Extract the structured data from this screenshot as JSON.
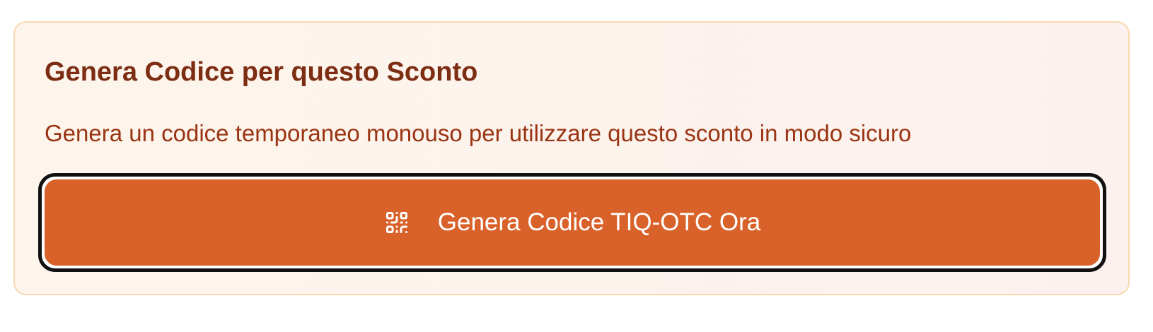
{
  "card": {
    "title": "Genera Codice per questo Sconto",
    "description": "Genera un codice temporaneo monouso per utilizzare questo sconto in modo sicuro",
    "button": {
      "label": "Genera Codice TIQ-OTC Ora",
      "icon": "qr-code-icon"
    }
  },
  "colors": {
    "card_border": "#f9d9b0",
    "card_background": "#fdf5ec",
    "title": "#7c2d12",
    "description": "#9a3412",
    "button_background": "#d9622b",
    "button_text": "#ffffff"
  }
}
